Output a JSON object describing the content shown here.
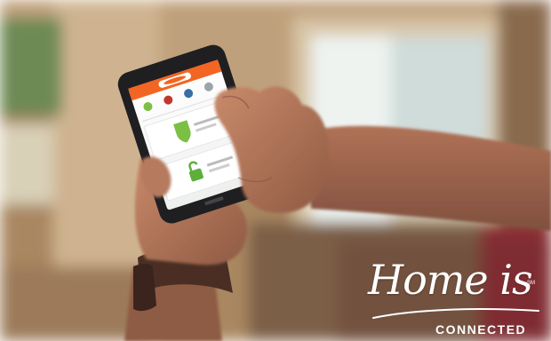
{
  "scene": {
    "description_type": "marketing-photo",
    "colors": {
      "app_header_orange": "#F26522",
      "shield_green": "#7BC043",
      "lock_green": "#5DAE3A",
      "background_warm": "#C9A57E",
      "window_light": "#EFF4F2"
    }
  },
  "phone": {
    "app": {
      "header_logo": "logo",
      "icons": [
        "leaf-icon",
        "home-icon",
        "moon-icon",
        "away-icon"
      ],
      "sections": [
        {
          "icon": "shield-icon",
          "label": ""
        },
        {
          "icon": "lock-icon",
          "label": ""
        }
      ]
    }
  },
  "tagline": {
    "script": "Home is",
    "trademark": "SM",
    "subline": "CONNECTED"
  }
}
